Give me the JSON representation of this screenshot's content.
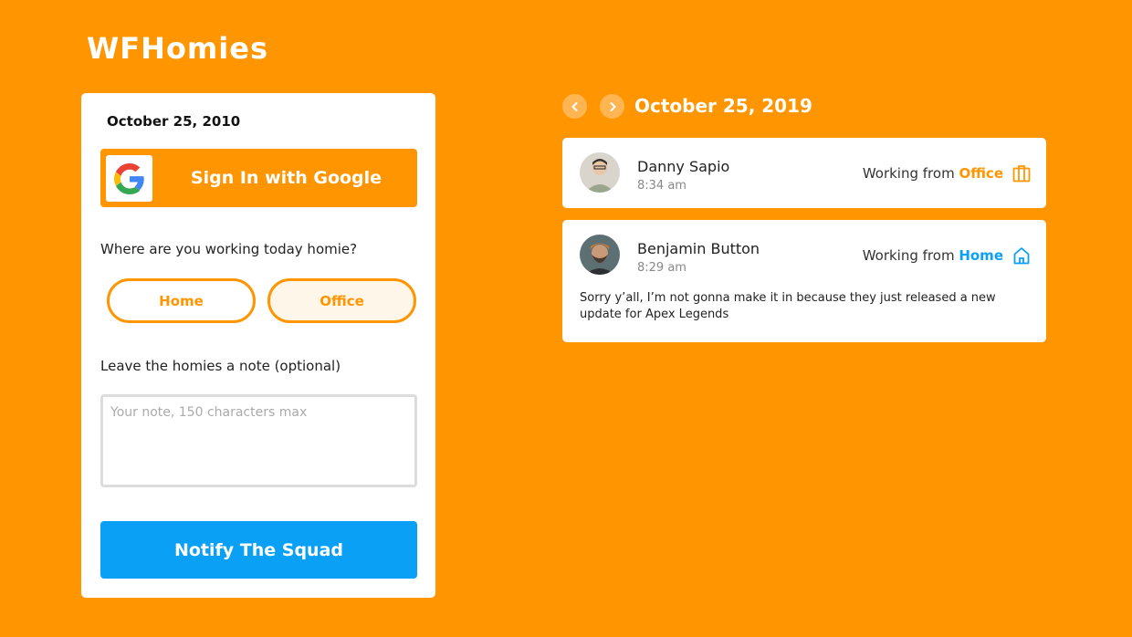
{
  "app": {
    "title": "WFHomies"
  },
  "form": {
    "date": "October 25, 2010",
    "google_button_label": "Sign In with Google",
    "question": "Where are you working today homie?",
    "locations": [
      {
        "label": "Home",
        "selected": false
      },
      {
        "label": "Office",
        "selected": true
      }
    ],
    "note_label": "Leave the homies a note (optional)",
    "note_placeholder": "Your note, 150 characters max",
    "note_value": "",
    "submit_label": "Notify The Squad"
  },
  "feed": {
    "date": "October 25, 2019",
    "prev_icon": "chevron-left-icon",
    "next_icon": "chevron-right-icon",
    "entries": [
      {
        "name": "Danny Sapio",
        "time": "8:34 am",
        "status_prefix": "Working from ",
        "location": "Office",
        "location_color": "#FF9500",
        "icon": "building-icon",
        "note": ""
      },
      {
        "name": "Benjamin Button",
        "time": "8:29 am",
        "status_prefix": "Working from ",
        "location": "Home",
        "location_color": "#0AA0F5",
        "icon": "house-icon",
        "note": "Sorry y’all, I’m not gonna make it in because they just released a new update for Apex Legends"
      }
    ]
  },
  "colors": {
    "background": "#FF9500",
    "accent_orange": "#FF9500",
    "accent_blue": "#0AA0F5",
    "card": "#FFFFFF"
  }
}
